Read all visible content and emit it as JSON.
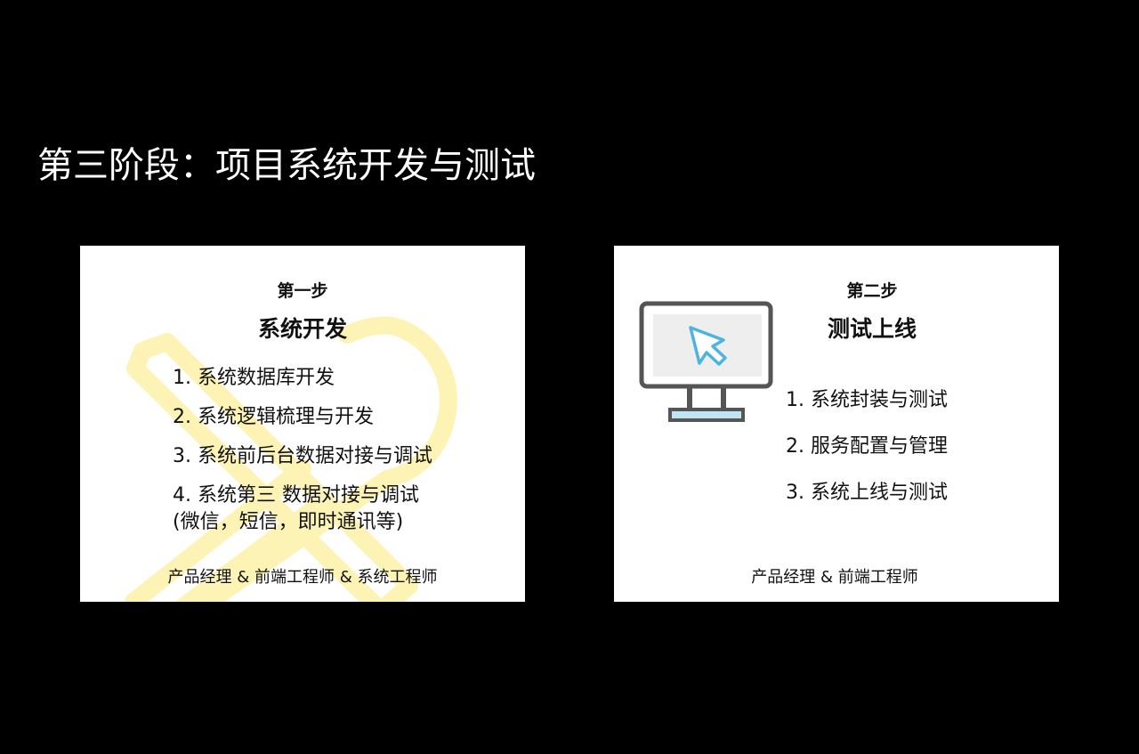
{
  "page": {
    "title": "第三阶段：项目系统开发与测试"
  },
  "colors": {
    "background": "#000000",
    "card": "#ffffff",
    "watermark": "#fdf3b4",
    "monitor_frame": "#555555",
    "cursor": "#4db3e0"
  },
  "cards": [
    {
      "step": "第一步",
      "heading": "系统开发",
      "icon": "tools-watermark-icon",
      "items": [
        {
          "main": "1. 系统数据库开发"
        },
        {
          "main": "2. 系统逻辑梳理与开发"
        },
        {
          "main": "3. 系统前后台数据对接与调试"
        },
        {
          "main": "4. 系统第三 数据对接与调试",
          "sub": "(微信，短信，即时通讯等)"
        }
      ],
      "roles": "产品经理 & 前端工程师 & 系统工程师"
    },
    {
      "step": "第二步",
      "heading": "测试上线",
      "icon": "monitor-cursor-icon",
      "items": [
        {
          "main": "1. 系统封装与测试"
        },
        {
          "main": "2. 服务配置与管理"
        },
        {
          "main": "3. 系统上线与测试"
        }
      ],
      "roles": "产品经理 & 前端工程师"
    }
  ]
}
